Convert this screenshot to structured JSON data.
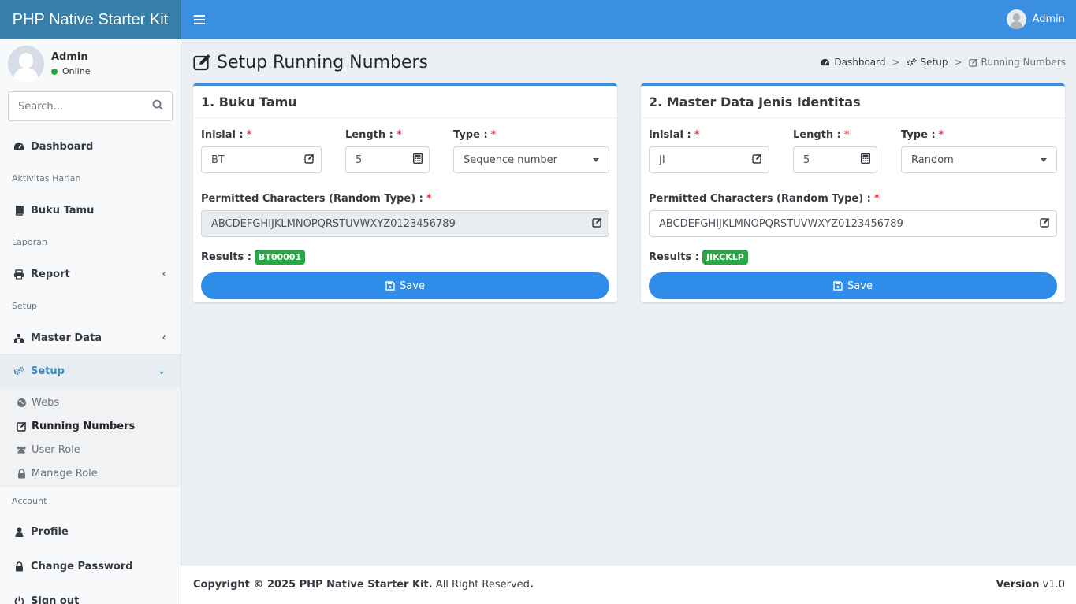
{
  "app": {
    "brand": "PHP Native Starter Kit"
  },
  "user": {
    "name": "Admin",
    "status": "Online"
  },
  "search": {
    "placeholder": "Search..."
  },
  "sidebar": {
    "dashboard": "Dashboard",
    "header_aktivitas": "Aktivitas Harian",
    "buku_tamu": "Buku Tamu",
    "header_laporan": "Laporan",
    "report": "Report",
    "header_setup": "Setup",
    "master_data": "Master Data",
    "setup": "Setup",
    "sub_items": [
      "Webs",
      "Running Numbers",
      "User Role",
      "Manage Role"
    ],
    "header_account": "Account",
    "profile": "Profile",
    "change_password": "Change Password",
    "sign_out": "Sign out"
  },
  "topbar": {
    "user_name": "Admin"
  },
  "page": {
    "title": "Setup Running Numbers",
    "breadcrumb": [
      "Dashboard",
      "Setup",
      "Running Numbers"
    ]
  },
  "labels": {
    "inisial": "Inisial :",
    "length": "Length :",
    "type": "Type :",
    "permitted": "Permitted Characters (Random Type) :",
    "required": "*",
    "results": "Results :",
    "save": "Save"
  },
  "cards": [
    {
      "title": "1. Buku Tamu",
      "inisial": "BT",
      "length": "5",
      "type": "Sequence number",
      "permitted": "ABCDEFGHIJKLMNOPQRSTUVWXYZ0123456789",
      "permitted_disabled": true,
      "result": "BT00001"
    },
    {
      "title": "2. Master Data Jenis Identitas",
      "inisial": "JI",
      "length": "5",
      "type": "Random",
      "permitted": "ABCDEFGHIJKLMNOPQRSTUVWXYZ0123456789",
      "permitted_disabled": false,
      "result": "JIKCKLP"
    }
  ],
  "footer": {
    "copyright_bold": "Copyright © 2025 PHP Native Starter Kit.",
    "copyright_rest": " All Right Reserved",
    "copyright_dot": ".",
    "version_label": "Version",
    "version_value": " v1.0"
  },
  "colors": {
    "primary": "#3b8fe0",
    "brand_bg": "#367fa9",
    "success": "#28a745",
    "required": "#dc3545"
  }
}
